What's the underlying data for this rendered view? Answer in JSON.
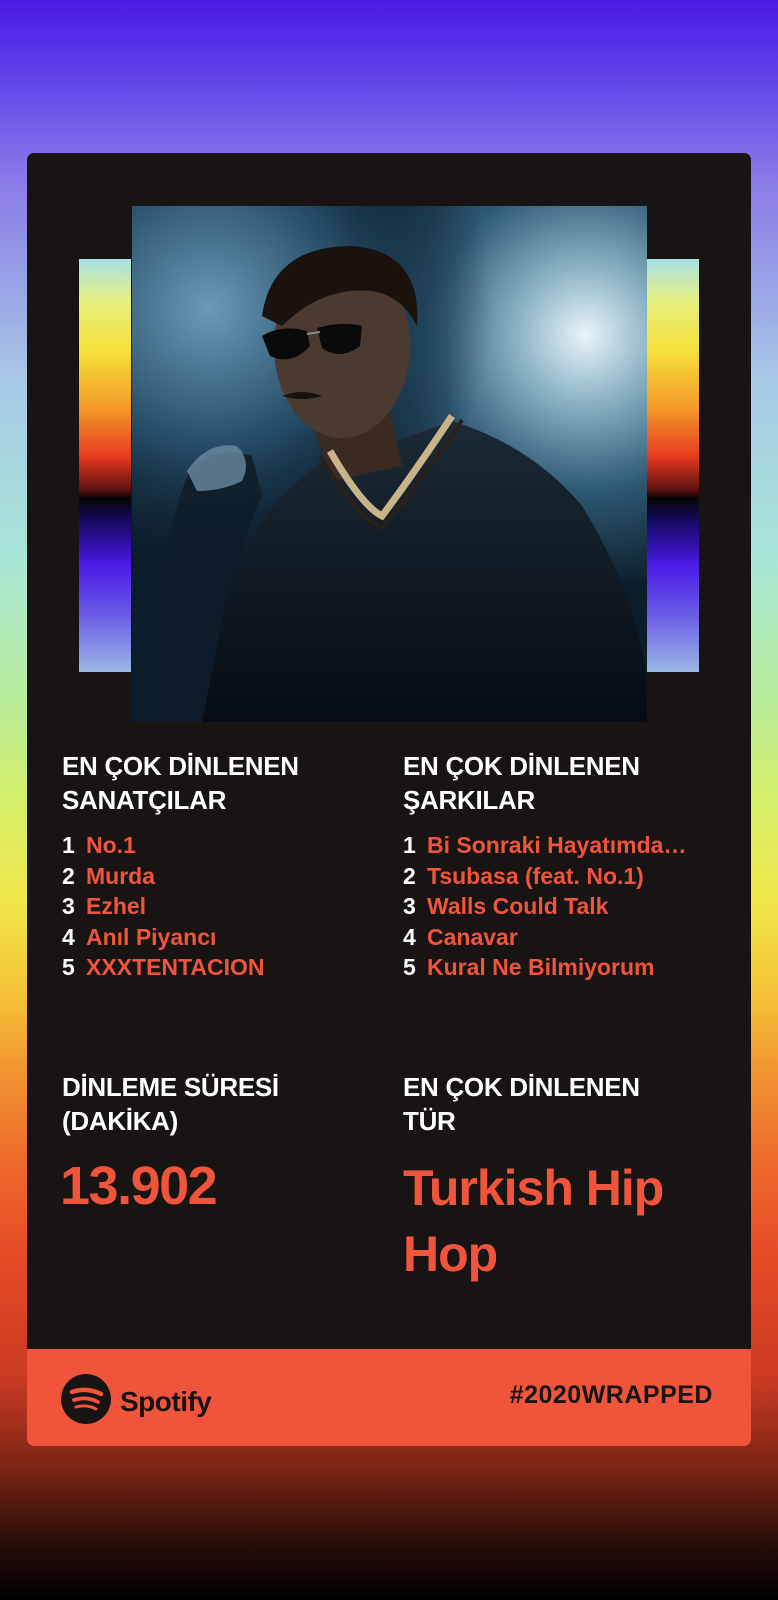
{
  "artists_section": {
    "title_line1": "EN ÇOK DİNLENEN",
    "title_line2": "SANATÇILAR",
    "items": [
      {
        "rank": "1",
        "name": "No.1"
      },
      {
        "rank": "2",
        "name": "Murda"
      },
      {
        "rank": "3",
        "name": "Ezhel"
      },
      {
        "rank": "4",
        "name": "Anıl Piyancı"
      },
      {
        "rank": "5",
        "name": "XXXTENTACION"
      }
    ]
  },
  "songs_section": {
    "title_line1": "EN ÇOK DİNLENEN",
    "title_line2": "ŞARKILAR",
    "items": [
      {
        "rank": "1",
        "name": "Bi Sonraki Hayatımda…"
      },
      {
        "rank": "2",
        "name": "Tsubasa (feat. No.1)"
      },
      {
        "rank": "3",
        "name": "Walls Could Talk"
      },
      {
        "rank": "4",
        "name": "Canavar"
      },
      {
        "rank": "5",
        "name": "Kural Ne Bilmiyorum"
      }
    ]
  },
  "minutes_section": {
    "title_line1": "DİNLEME SÜRESİ",
    "title_line2": "(DAKİKA)",
    "value": "13.902"
  },
  "genre_section": {
    "title_line1": "EN ÇOK DİNLENEN",
    "title_line2": "TÜR",
    "value": "Turkish Hip Hop"
  },
  "footer": {
    "brand": "Spotify",
    "hashtag": "#2020WRAPPED"
  },
  "icons": {
    "brand_logo": "spotify-icon"
  },
  "colors": {
    "card_background": "#191414",
    "accent": "#f0553b",
    "text": "#ffffff"
  }
}
